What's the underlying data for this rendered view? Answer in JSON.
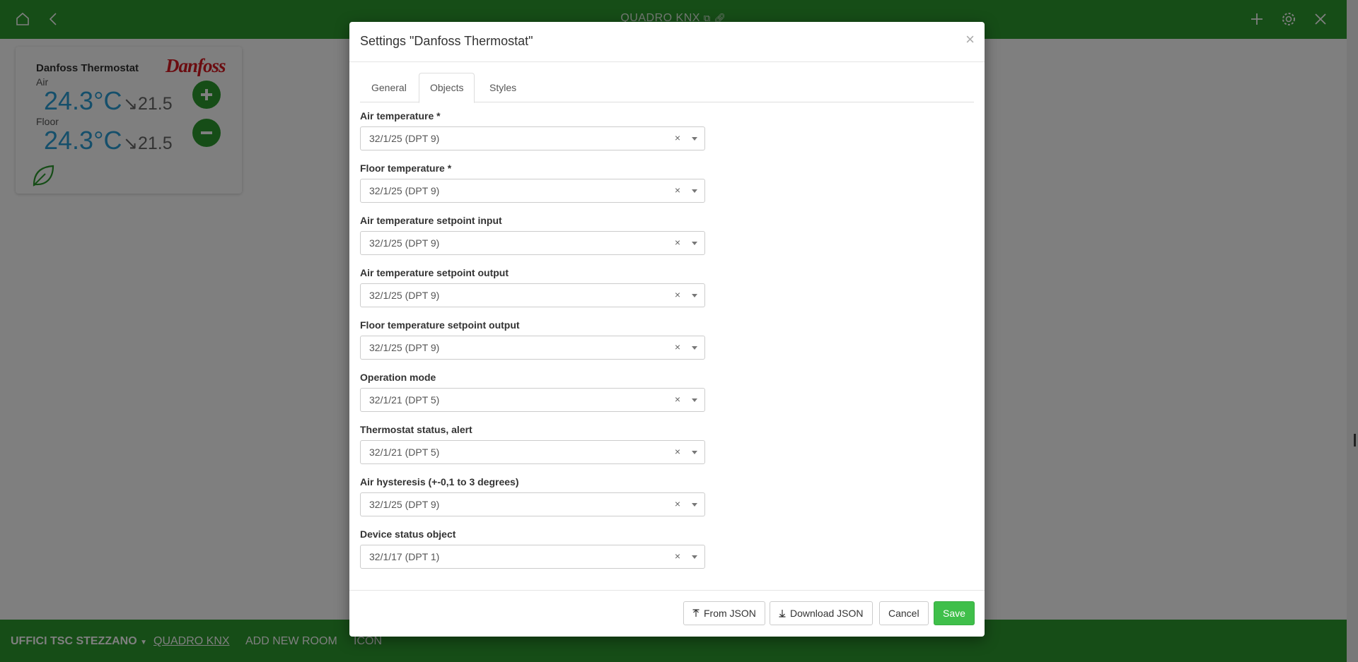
{
  "app": {
    "title": "QUADRO KNX",
    "icons": [
      "home-icon",
      "back-icon",
      "copy-icon",
      "link-icon",
      "plus-icon",
      "gear-icon",
      "close-icon"
    ],
    "accent_color": "#2c9a2e"
  },
  "widget": {
    "title": "Danfoss Thermostat",
    "logo_text": "Danfoss",
    "air_label": "Air",
    "air_temp": "24.3°C",
    "air_setpoint": "↘21.5",
    "floor_label": "Floor",
    "floor_temp": "24.3°C",
    "floor_setpoint": "↘21.5"
  },
  "bottom_nav": {
    "building": "UFFICI TSC STEZZANO",
    "items": [
      "QUADRO KNX",
      "ADD NEW ROOM",
      "ICON"
    ]
  },
  "modal": {
    "title": "Settings \"Danfoss Thermostat\"",
    "close": "×",
    "tabs": [
      {
        "label": "General",
        "active": false
      },
      {
        "label": "Objects",
        "active": true
      },
      {
        "label": "Styles",
        "active": false
      }
    ],
    "fields": [
      {
        "label": "Air temperature *",
        "value": "32/1/25 (DPT 9)"
      },
      {
        "label": "Floor temperature *",
        "value": "32/1/25 (DPT 9)"
      },
      {
        "label": "Air temperature setpoint input",
        "value": "32/1/25 (DPT 9)"
      },
      {
        "label": "Air temperature setpoint output",
        "value": "32/1/25 (DPT 9)"
      },
      {
        "label": "Floor temperature setpoint output",
        "value": "32/1/25 (DPT 9)"
      },
      {
        "label": "Operation mode",
        "value": "32/1/21 (DPT 5)"
      },
      {
        "label": "Thermostat status, alert",
        "value": "32/1/21 (DPT 5)"
      },
      {
        "label": "Air hysteresis (+-0,1 to 3 degrees)",
        "value": "32/1/25 (DPT 9)"
      },
      {
        "label": "Device status object",
        "value": "32/1/17 (DPT 1)"
      }
    ],
    "clear_glyph": "×",
    "footer": {
      "from_json": "From JSON",
      "download_json": "Download JSON",
      "cancel": "Cancel",
      "save": "Save"
    }
  }
}
